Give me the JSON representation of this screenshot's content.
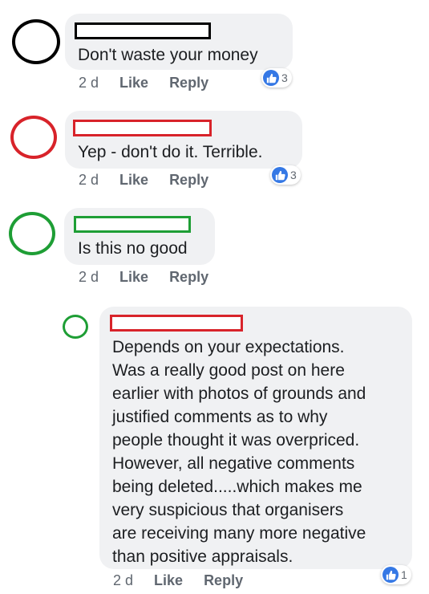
{
  "colors": {
    "black": "#000000",
    "red": "#d8232a",
    "green": "#1e9e35",
    "like_blue": "#3578e5"
  },
  "comments": [
    {
      "text": "Don't waste your money",
      "time": "2 d",
      "like": "Like",
      "reply": "Reply",
      "reactions": "3",
      "avatar_color": "black"
    },
    {
      "text": "Yep - don't do it. Terrible.",
      "time": "2 d",
      "like": "Like",
      "reply": "Reply",
      "reactions": "3",
      "avatar_color": "red"
    },
    {
      "text": "Is this no good",
      "time": "2 d",
      "like": "Like",
      "reply": "Reply",
      "avatar_color": "green"
    }
  ],
  "reply": {
    "lines": [
      "Depends on your expectations.",
      "Was a really good post on here",
      "earlier with photos of grounds and",
      "justified comments as to why",
      "people thought it was overpriced.",
      "However, all negative comments",
      "being deleted.....which makes me",
      "very suspicious that organisers",
      "are receiving many more negative",
      "than positive appraisals."
    ],
    "time": "2 d",
    "like": "Like",
    "reply": "Reply",
    "reactions": "1",
    "avatar_color": "green",
    "namebar_color": "red"
  }
}
